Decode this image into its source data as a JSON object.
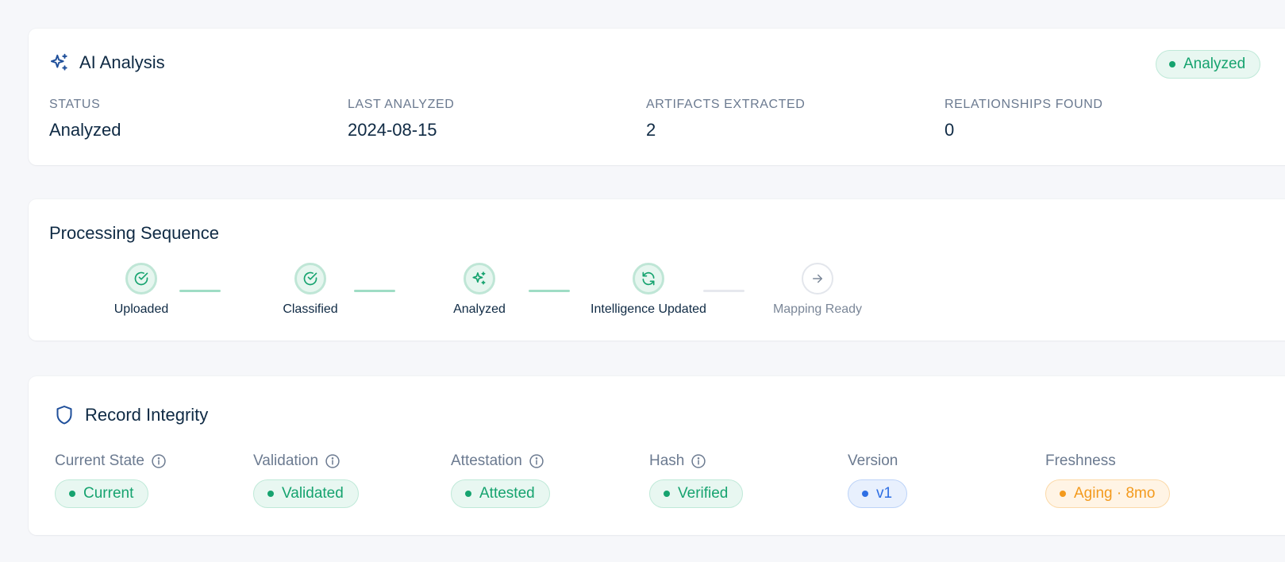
{
  "ai_analysis": {
    "title": "AI Analysis",
    "icon": "sparkles-icon",
    "status_badge": "Analyzed",
    "stats": [
      {
        "label": "STATUS",
        "value": "Analyzed"
      },
      {
        "label": "LAST ANALYZED",
        "value": "2024-08-15"
      },
      {
        "label": "ARTIFACTS EXTRACTED",
        "value": "2"
      },
      {
        "label": "RELATIONSHIPS FOUND",
        "value": "0"
      }
    ]
  },
  "processing": {
    "title": "Processing Sequence",
    "steps": [
      {
        "label": "Uploaded",
        "icon": "check-circle-icon",
        "state": "complete"
      },
      {
        "label": "Classified",
        "icon": "check-circle-icon",
        "state": "complete"
      },
      {
        "label": "Analyzed",
        "icon": "sparkles-icon",
        "state": "complete"
      },
      {
        "label": "Intelligence Updated",
        "icon": "refresh-icon",
        "state": "complete"
      },
      {
        "label": "Mapping Ready",
        "icon": "arrow-right-icon",
        "state": "pending"
      }
    ]
  },
  "integrity": {
    "title": "Record Integrity",
    "icon": "shield-icon",
    "attributes": [
      {
        "label": "Current State",
        "value": "Current",
        "info": true,
        "color": "green"
      },
      {
        "label": "Validation",
        "value": "Validated",
        "info": true,
        "color": "green"
      },
      {
        "label": "Attestation",
        "value": "Attested",
        "info": true,
        "color": "green"
      },
      {
        "label": "Hash",
        "value": "Verified",
        "info": true,
        "color": "green"
      },
      {
        "label": "Version",
        "value": "v1",
        "info": false,
        "color": "blue"
      },
      {
        "label": "Freshness",
        "value": "Aging · 8mo",
        "info": false,
        "color": "orange"
      }
    ]
  },
  "colors": {
    "success": "#16a36f",
    "info": "#2f6fe4",
    "warning": "#f39a1d",
    "heading": "#0f2a44",
    "muted": "#6b7a90"
  }
}
